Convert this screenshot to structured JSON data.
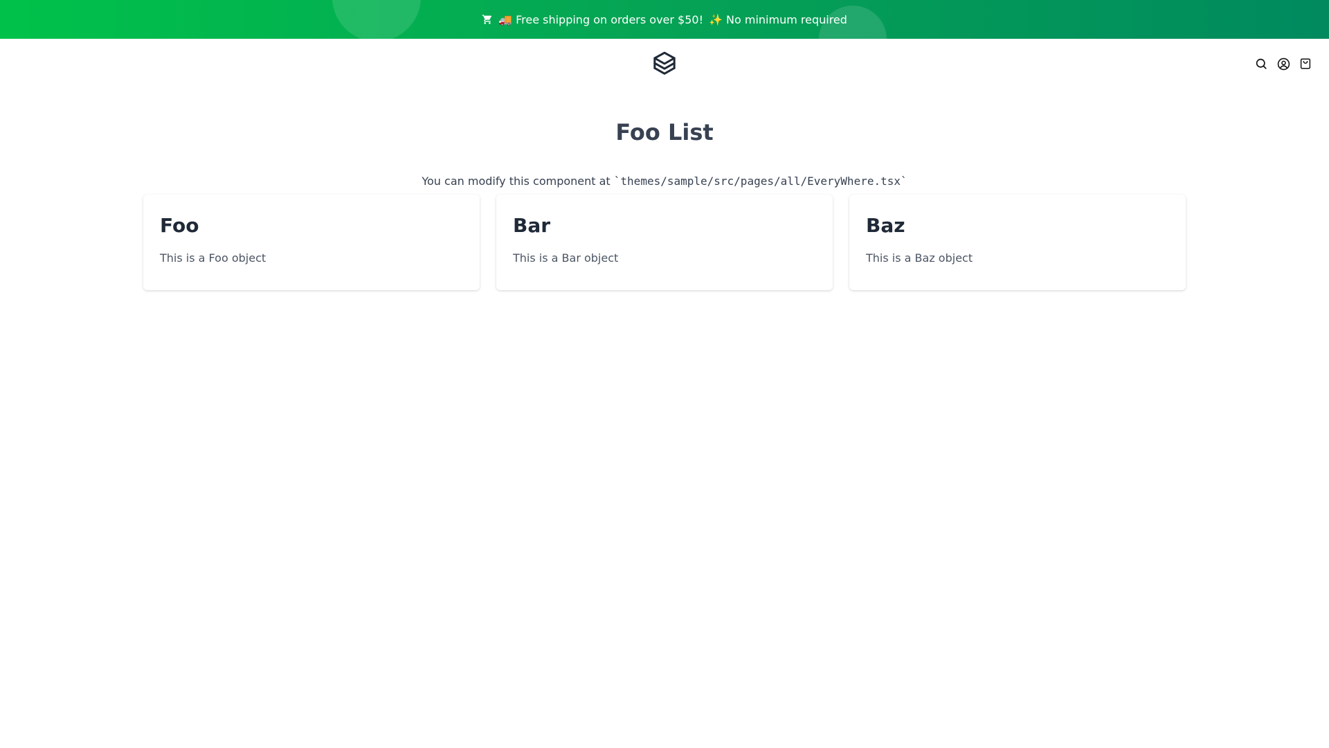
{
  "promo": {
    "shipping_text": "🚚 Free shipping on orders over $50!",
    "min_text": "✨ No minimum required",
    "cart_icon": "shopping-cart-icon",
    "gradient_start": "#00c24a",
    "gradient_end": "#008a5e"
  },
  "header": {
    "logo_icon": "layers-logo-icon",
    "icons": [
      "search-icon",
      "user-icon",
      "shopping-bag-icon"
    ]
  },
  "main": {
    "title": "Foo List",
    "description_prefix": "You can modify this component at ",
    "description_path": "`themes/sample/src/pages/all/EveryWhere.tsx`",
    "cards": [
      {
        "title": "Foo",
        "body": "This is a Foo object"
      },
      {
        "title": "Bar",
        "body": "This is a Bar object"
      },
      {
        "title": "Baz",
        "body": "This is a Baz object"
      }
    ]
  }
}
